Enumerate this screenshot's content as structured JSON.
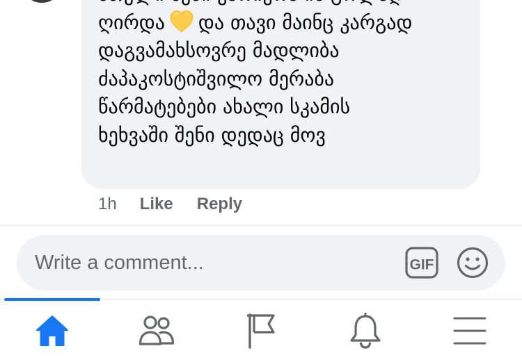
{
  "comment": {
    "text_before_emoji": "მთელი შენი კარიერა იმ გოლად\nღირდა",
    "emoji": "yellow-heart",
    "text_after_emoji": "და თავი მაინც კარგად\nდაგვამახსოვრე მადლიბა\nძაპაკოსტიშვილო მერაბა\nწარმატებები ახალი სკამის\nხეხვაში შენი დედაც მოვ",
    "time": "1h",
    "like_label": "Like",
    "reply_label": "Reply"
  },
  "composer": {
    "placeholder": "Write a comment...",
    "gif_label": "GIF",
    "emoji_icon": "smiley-icon"
  },
  "bottom_nav": {
    "active_tab": "home",
    "tabs": [
      {
        "id": "home",
        "icon": "home-icon"
      },
      {
        "id": "friends",
        "icon": "friends-icon"
      },
      {
        "id": "pages",
        "icon": "flag-icon"
      },
      {
        "id": "notifications",
        "icon": "bell-icon"
      },
      {
        "id": "menu",
        "icon": "menu-icon"
      }
    ]
  },
  "colors": {
    "accent": "#1877f2",
    "bubble_bg": "#f0f2f5",
    "secondary_text": "#65676b",
    "icon_gray": "#65676b",
    "heart_yellow": "#ffcc4d"
  }
}
